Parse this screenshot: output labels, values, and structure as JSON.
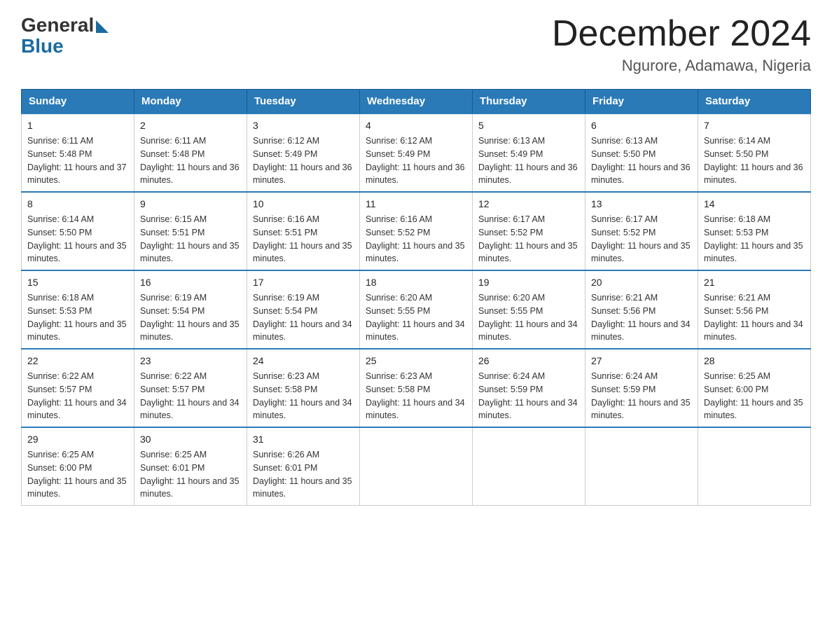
{
  "logo": {
    "general": "General",
    "blue": "Blue",
    "arrow_color": "#1a6ba0"
  },
  "title": {
    "month_year": "December 2024",
    "location": "Ngurore, Adamawa, Nigeria"
  },
  "headers": [
    "Sunday",
    "Monday",
    "Tuesday",
    "Wednesday",
    "Thursday",
    "Friday",
    "Saturday"
  ],
  "weeks": [
    [
      {
        "day": "1",
        "sunrise": "Sunrise: 6:11 AM",
        "sunset": "Sunset: 5:48 PM",
        "daylight": "Daylight: 11 hours and 37 minutes."
      },
      {
        "day": "2",
        "sunrise": "Sunrise: 6:11 AM",
        "sunset": "Sunset: 5:48 PM",
        "daylight": "Daylight: 11 hours and 36 minutes."
      },
      {
        "day": "3",
        "sunrise": "Sunrise: 6:12 AM",
        "sunset": "Sunset: 5:49 PM",
        "daylight": "Daylight: 11 hours and 36 minutes."
      },
      {
        "day": "4",
        "sunrise": "Sunrise: 6:12 AM",
        "sunset": "Sunset: 5:49 PM",
        "daylight": "Daylight: 11 hours and 36 minutes."
      },
      {
        "day": "5",
        "sunrise": "Sunrise: 6:13 AM",
        "sunset": "Sunset: 5:49 PM",
        "daylight": "Daylight: 11 hours and 36 minutes."
      },
      {
        "day": "6",
        "sunrise": "Sunrise: 6:13 AM",
        "sunset": "Sunset: 5:50 PM",
        "daylight": "Daylight: 11 hours and 36 minutes."
      },
      {
        "day": "7",
        "sunrise": "Sunrise: 6:14 AM",
        "sunset": "Sunset: 5:50 PM",
        "daylight": "Daylight: 11 hours and 36 minutes."
      }
    ],
    [
      {
        "day": "8",
        "sunrise": "Sunrise: 6:14 AM",
        "sunset": "Sunset: 5:50 PM",
        "daylight": "Daylight: 11 hours and 35 minutes."
      },
      {
        "day": "9",
        "sunrise": "Sunrise: 6:15 AM",
        "sunset": "Sunset: 5:51 PM",
        "daylight": "Daylight: 11 hours and 35 minutes."
      },
      {
        "day": "10",
        "sunrise": "Sunrise: 6:16 AM",
        "sunset": "Sunset: 5:51 PM",
        "daylight": "Daylight: 11 hours and 35 minutes."
      },
      {
        "day": "11",
        "sunrise": "Sunrise: 6:16 AM",
        "sunset": "Sunset: 5:52 PM",
        "daylight": "Daylight: 11 hours and 35 minutes."
      },
      {
        "day": "12",
        "sunrise": "Sunrise: 6:17 AM",
        "sunset": "Sunset: 5:52 PM",
        "daylight": "Daylight: 11 hours and 35 minutes."
      },
      {
        "day": "13",
        "sunrise": "Sunrise: 6:17 AM",
        "sunset": "Sunset: 5:52 PM",
        "daylight": "Daylight: 11 hours and 35 minutes."
      },
      {
        "day": "14",
        "sunrise": "Sunrise: 6:18 AM",
        "sunset": "Sunset: 5:53 PM",
        "daylight": "Daylight: 11 hours and 35 minutes."
      }
    ],
    [
      {
        "day": "15",
        "sunrise": "Sunrise: 6:18 AM",
        "sunset": "Sunset: 5:53 PM",
        "daylight": "Daylight: 11 hours and 35 minutes."
      },
      {
        "day": "16",
        "sunrise": "Sunrise: 6:19 AM",
        "sunset": "Sunset: 5:54 PM",
        "daylight": "Daylight: 11 hours and 35 minutes."
      },
      {
        "day": "17",
        "sunrise": "Sunrise: 6:19 AM",
        "sunset": "Sunset: 5:54 PM",
        "daylight": "Daylight: 11 hours and 34 minutes."
      },
      {
        "day": "18",
        "sunrise": "Sunrise: 6:20 AM",
        "sunset": "Sunset: 5:55 PM",
        "daylight": "Daylight: 11 hours and 34 minutes."
      },
      {
        "day": "19",
        "sunrise": "Sunrise: 6:20 AM",
        "sunset": "Sunset: 5:55 PM",
        "daylight": "Daylight: 11 hours and 34 minutes."
      },
      {
        "day": "20",
        "sunrise": "Sunrise: 6:21 AM",
        "sunset": "Sunset: 5:56 PM",
        "daylight": "Daylight: 11 hours and 34 minutes."
      },
      {
        "day": "21",
        "sunrise": "Sunrise: 6:21 AM",
        "sunset": "Sunset: 5:56 PM",
        "daylight": "Daylight: 11 hours and 34 minutes."
      }
    ],
    [
      {
        "day": "22",
        "sunrise": "Sunrise: 6:22 AM",
        "sunset": "Sunset: 5:57 PM",
        "daylight": "Daylight: 11 hours and 34 minutes."
      },
      {
        "day": "23",
        "sunrise": "Sunrise: 6:22 AM",
        "sunset": "Sunset: 5:57 PM",
        "daylight": "Daylight: 11 hours and 34 minutes."
      },
      {
        "day": "24",
        "sunrise": "Sunrise: 6:23 AM",
        "sunset": "Sunset: 5:58 PM",
        "daylight": "Daylight: 11 hours and 34 minutes."
      },
      {
        "day": "25",
        "sunrise": "Sunrise: 6:23 AM",
        "sunset": "Sunset: 5:58 PM",
        "daylight": "Daylight: 11 hours and 34 minutes."
      },
      {
        "day": "26",
        "sunrise": "Sunrise: 6:24 AM",
        "sunset": "Sunset: 5:59 PM",
        "daylight": "Daylight: 11 hours and 34 minutes."
      },
      {
        "day": "27",
        "sunrise": "Sunrise: 6:24 AM",
        "sunset": "Sunset: 5:59 PM",
        "daylight": "Daylight: 11 hours and 35 minutes."
      },
      {
        "day": "28",
        "sunrise": "Sunrise: 6:25 AM",
        "sunset": "Sunset: 6:00 PM",
        "daylight": "Daylight: 11 hours and 35 minutes."
      }
    ],
    [
      {
        "day": "29",
        "sunrise": "Sunrise: 6:25 AM",
        "sunset": "Sunset: 6:00 PM",
        "daylight": "Daylight: 11 hours and 35 minutes."
      },
      {
        "day": "30",
        "sunrise": "Sunrise: 6:25 AM",
        "sunset": "Sunset: 6:01 PM",
        "daylight": "Daylight: 11 hours and 35 minutes."
      },
      {
        "day": "31",
        "sunrise": "Sunrise: 6:26 AM",
        "sunset": "Sunset: 6:01 PM",
        "daylight": "Daylight: 11 hours and 35 minutes."
      },
      null,
      null,
      null,
      null
    ]
  ]
}
